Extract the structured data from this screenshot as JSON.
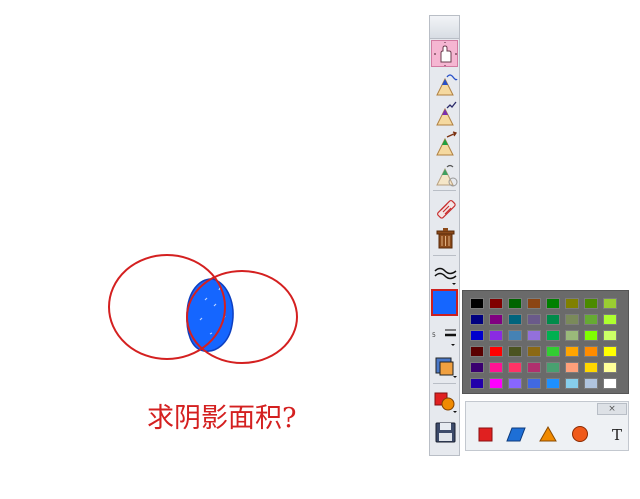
{
  "whiteboard": {
    "question_text": "求阴影面积?",
    "ink_color": "#d42020",
    "shade_color": "#1566ff"
  },
  "toolbar": {
    "tools": [
      {
        "name": "move-hand-tool",
        "icon": "hand-move-icon",
        "active": true
      },
      {
        "name": "pen-tool-blue",
        "icon": "pen-icon"
      },
      {
        "name": "pen-tool-purple",
        "icon": "pen-icon"
      },
      {
        "name": "pen-tool-green",
        "icon": "pen-icon"
      },
      {
        "name": "pen-tool-gray",
        "icon": "pen-icon"
      },
      {
        "name": "eraser-tool",
        "icon": "eraser-icon"
      },
      {
        "name": "delete-tool",
        "icon": "trash-icon"
      },
      {
        "name": "line-style-tool",
        "icon": "wave-line-icon"
      },
      {
        "name": "line-width-tool",
        "icon": "line-width-icon",
        "label": "5"
      },
      {
        "name": "fill-color-tool",
        "icon": "fill-color-icon"
      },
      {
        "name": "shape-tool",
        "icon": "shapes-icon"
      },
      {
        "name": "save-tool",
        "icon": "save-icon"
      }
    ],
    "current_color": "#1566ff"
  },
  "palette": {
    "colors": [
      [
        "#000000",
        "#800000",
        "#006400",
        "#8b4513",
        "#008000",
        "#808000",
        "#4b8b00",
        "#9acd32"
      ],
      [
        "#000080",
        "#800080",
        "#00647d",
        "#6a5a8a",
        "#008b4a",
        "#7a8a5a",
        "#66aa33",
        "#adff2f"
      ],
      [
        "#0000cd",
        "#8a2be2",
        "#4682b4",
        "#9370db",
        "#00b050",
        "#9aba7a",
        "#7fff00",
        "#ccff66"
      ],
      [
        "#5a0000",
        "#ff0000",
        "#4b5320",
        "#8b6914",
        "#32cd32",
        "#ffa500",
        "#ff8c00",
        "#ffff00"
      ],
      [
        "#3a0070",
        "#ff1493",
        "#ff3366",
        "#b0306e",
        "#48a070",
        "#ffa07a",
        "#ffd700",
        "#ffff99"
      ],
      [
        "#2200aa",
        "#ff00ff",
        "#8866ff",
        "#4169e1",
        "#1e90ff",
        "#87ceeb",
        "#b0c4de",
        "#ffffff"
      ]
    ]
  },
  "shape_panel": {
    "close_label": "×",
    "text_tool_label": "T",
    "shapes": [
      {
        "name": "rectangle-shape",
        "color": "#e02020"
      },
      {
        "name": "parallelogram-shape",
        "color": "#1e6fd6"
      },
      {
        "name": "triangle-shape",
        "color": "#f08a00"
      },
      {
        "name": "circle-shape",
        "color": "#f05a1a"
      }
    ]
  }
}
